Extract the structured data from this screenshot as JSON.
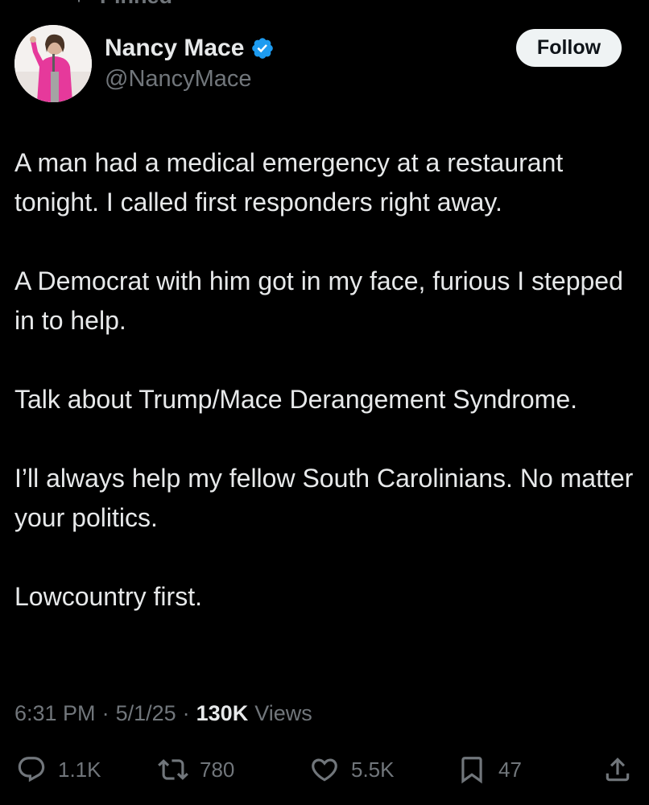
{
  "pinned": {
    "label": "Pinned"
  },
  "author": {
    "display_name": "Nancy Mace",
    "handle": "@NancyMace",
    "verified": true
  },
  "follow_button": {
    "label": "Follow"
  },
  "tweet": {
    "paragraphs": [
      "A man had a medical emergency at a restaurant tonight. I called first responders right away.",
      "A Democrat with him got in my face, furious I stepped in to help.",
      "Talk about Trump/Mace Derangement Syndrome.",
      "I’ll always help my fellow South Carolinians. No matter your politics.",
      "Lowcountry first."
    ]
  },
  "meta": {
    "time": "6:31 PM",
    "separator": "·",
    "date": "5/1/25",
    "views_count": "130K",
    "views_label": "Views"
  },
  "actions": {
    "replies": "1.1K",
    "reposts": "780",
    "likes": "5.5K",
    "bookmarks": "47"
  },
  "colors": {
    "background": "#000000",
    "text_primary": "#e7e9ea",
    "text_secondary": "#71767b",
    "verified_badge": "#1d9bf0",
    "follow_button_bg": "#eff3f4"
  },
  "icons": {
    "pinned": "pin-icon",
    "verified": "verified-badge-icon",
    "reply": "reply-icon",
    "repost": "repost-icon",
    "like": "heart-icon",
    "bookmark": "bookmark-icon",
    "share": "share-icon"
  }
}
